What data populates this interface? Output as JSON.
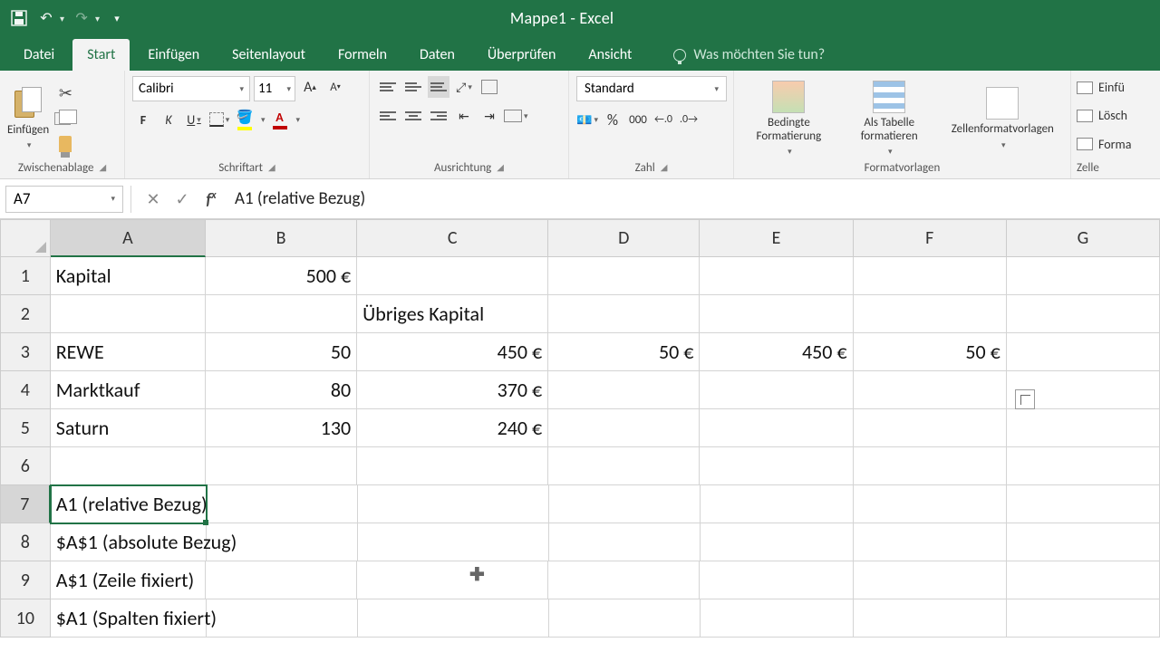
{
  "app": {
    "title": "Mappe1 - Excel"
  },
  "tabs": {
    "file": "Datei",
    "home": "Start",
    "insert": "Einfügen",
    "layout": "Seitenlayout",
    "formulas": "Formeln",
    "data": "Daten",
    "review": "Überprüfen",
    "view": "Ansicht",
    "tellme": "Was möchten Sie tun?"
  },
  "ribbon": {
    "clipboard": {
      "paste": "Einfügen",
      "label": "Zwischenablage"
    },
    "font": {
      "name": "Calibri",
      "size": "11",
      "bold": "F",
      "italic": "K",
      "underline": "U",
      "label": "Schriftart"
    },
    "align": {
      "label": "Ausrichtung"
    },
    "number": {
      "format": "Standard",
      "label": "Zahl"
    },
    "styles": {
      "cond": "Bedingte Formatierung",
      "table": "Als Tabelle formatieren",
      "cell": "Zellenformatvorlagen",
      "label": "Formatvorlagen"
    },
    "cells": {
      "insert": "Einfü",
      "delete": "Lösch",
      "format": "Forma",
      "label": "Zelle"
    }
  },
  "namebox": "A7",
  "formula": "A1 (relative Bezug)",
  "cols": [
    "A",
    "B",
    "C",
    "D",
    "E",
    "F",
    "G"
  ],
  "rows": [
    "1",
    "2",
    "3",
    "4",
    "5",
    "6",
    "7",
    "8",
    "9",
    "10"
  ],
  "cells": {
    "A1": "Kapital",
    "B1": "500 €",
    "C2": "Übriges Kapital",
    "A3": "REWE",
    "B3": "50",
    "C3": "450 €",
    "D3": "50 €",
    "E3": "450 €",
    "F3": "50 €",
    "A4": "Marktkauf",
    "B4": "80",
    "C4": "370 €",
    "A5": "Saturn",
    "B5": "130",
    "C5": "240 €",
    "A7": "A1 (relative Bezug)",
    "A8": "$A$1 (absolute Bezug)",
    "A9": "A$1 (Zeile fixiert)",
    "A10": "$A1 (Spalten fixiert)"
  }
}
